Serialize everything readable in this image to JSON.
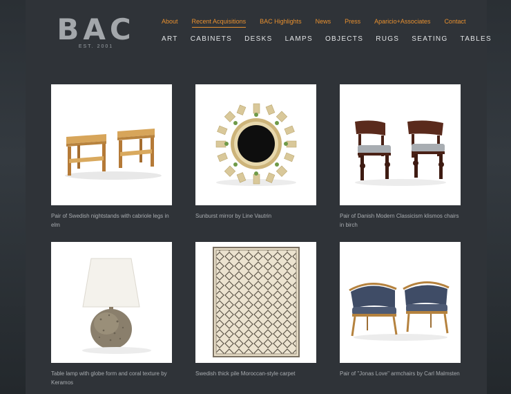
{
  "logo": {
    "mark": "BAC",
    "est": "EST. 2001"
  },
  "top_nav": [
    {
      "label": "About",
      "active": false
    },
    {
      "label": "Recent Acquisitions",
      "active": true
    },
    {
      "label": "BAC Highlights",
      "active": false
    },
    {
      "label": "News",
      "active": false
    },
    {
      "label": "Press",
      "active": false
    },
    {
      "label": "Aparicio+Associates",
      "active": false
    },
    {
      "label": "Contact",
      "active": false
    }
  ],
  "category_nav": [
    "ART",
    "CABINETS",
    "DESKS",
    "LAMPS",
    "OBJECTS",
    "RUGS",
    "SEATING",
    "TABLES"
  ],
  "items": [
    {
      "caption": "Pair of Swedish nightstands with cabriole legs in elm",
      "image": "nightstands-image"
    },
    {
      "caption": "Sunburst mirror by Line Vautrin",
      "image": "sunburst-mirror-image"
    },
    {
      "caption": "Pair of Danish Modern Classicism klismos chairs in birch",
      "image": "klismos-chairs-image"
    },
    {
      "caption": "Table lamp with globe form and coral texture by Keramos",
      "image": "table-lamp-image"
    },
    {
      "caption": "Swedish thick pile Moroccan-style carpet",
      "image": "carpet-image"
    },
    {
      "caption": "Pair of \"Jonas Love\" armchairs by Carl Malmsten",
      "image": "armchairs-image"
    }
  ],
  "colors": {
    "accent": "#e8902f",
    "page_bg": "#2f3338",
    "nav_text": "#e2e4e6",
    "caption_text": "#a9adb1"
  }
}
